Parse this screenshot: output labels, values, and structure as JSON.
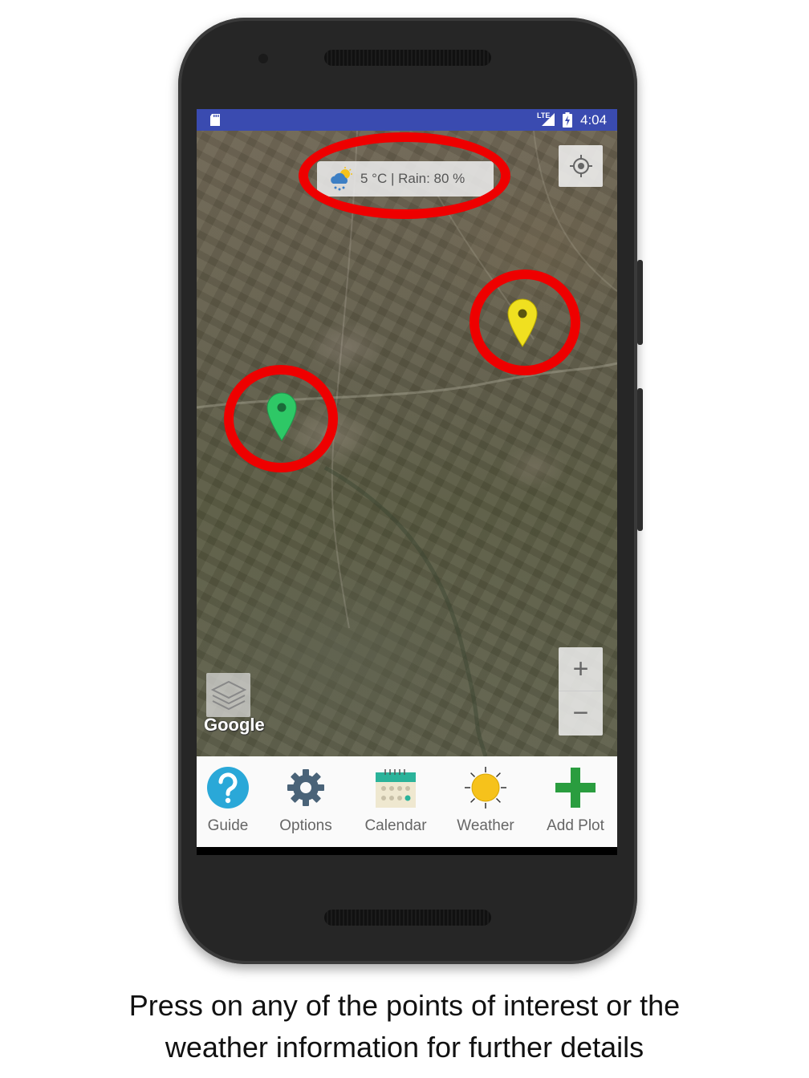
{
  "status_bar": {
    "network": "LTE",
    "time": "4:04"
  },
  "map": {
    "weather_chip": {
      "text": "5 °C | Rain: 80 %",
      "icon": "cloud-rain-sun-icon"
    },
    "attribution": "Google",
    "markers": [
      {
        "name": "green-marker",
        "color": "#2ec866"
      },
      {
        "name": "yellow-marker",
        "color": "#f0e020"
      }
    ],
    "controls": {
      "locate": "crosshair-icon",
      "layers": "layers-icon",
      "zoom_in": "+",
      "zoom_out": "−"
    },
    "highlight_color": "#ee0000"
  },
  "nav": {
    "items": [
      {
        "label": "Guide",
        "icon": "question-icon",
        "color": "#2aa8d8"
      },
      {
        "label": "Options",
        "icon": "gear-icon",
        "color": "#4a6378"
      },
      {
        "label": "Calendar",
        "icon": "calendar-icon",
        "color": "#2bb39a"
      },
      {
        "label": "Weather",
        "icon": "sun-icon",
        "color": "#f6c21b"
      },
      {
        "label": "Add Plot",
        "icon": "plus-icon",
        "color": "#2a9d3f"
      }
    ]
  },
  "caption": {
    "line1": "Press on any of the points of interest or the",
    "line2": "weather information for further details"
  }
}
